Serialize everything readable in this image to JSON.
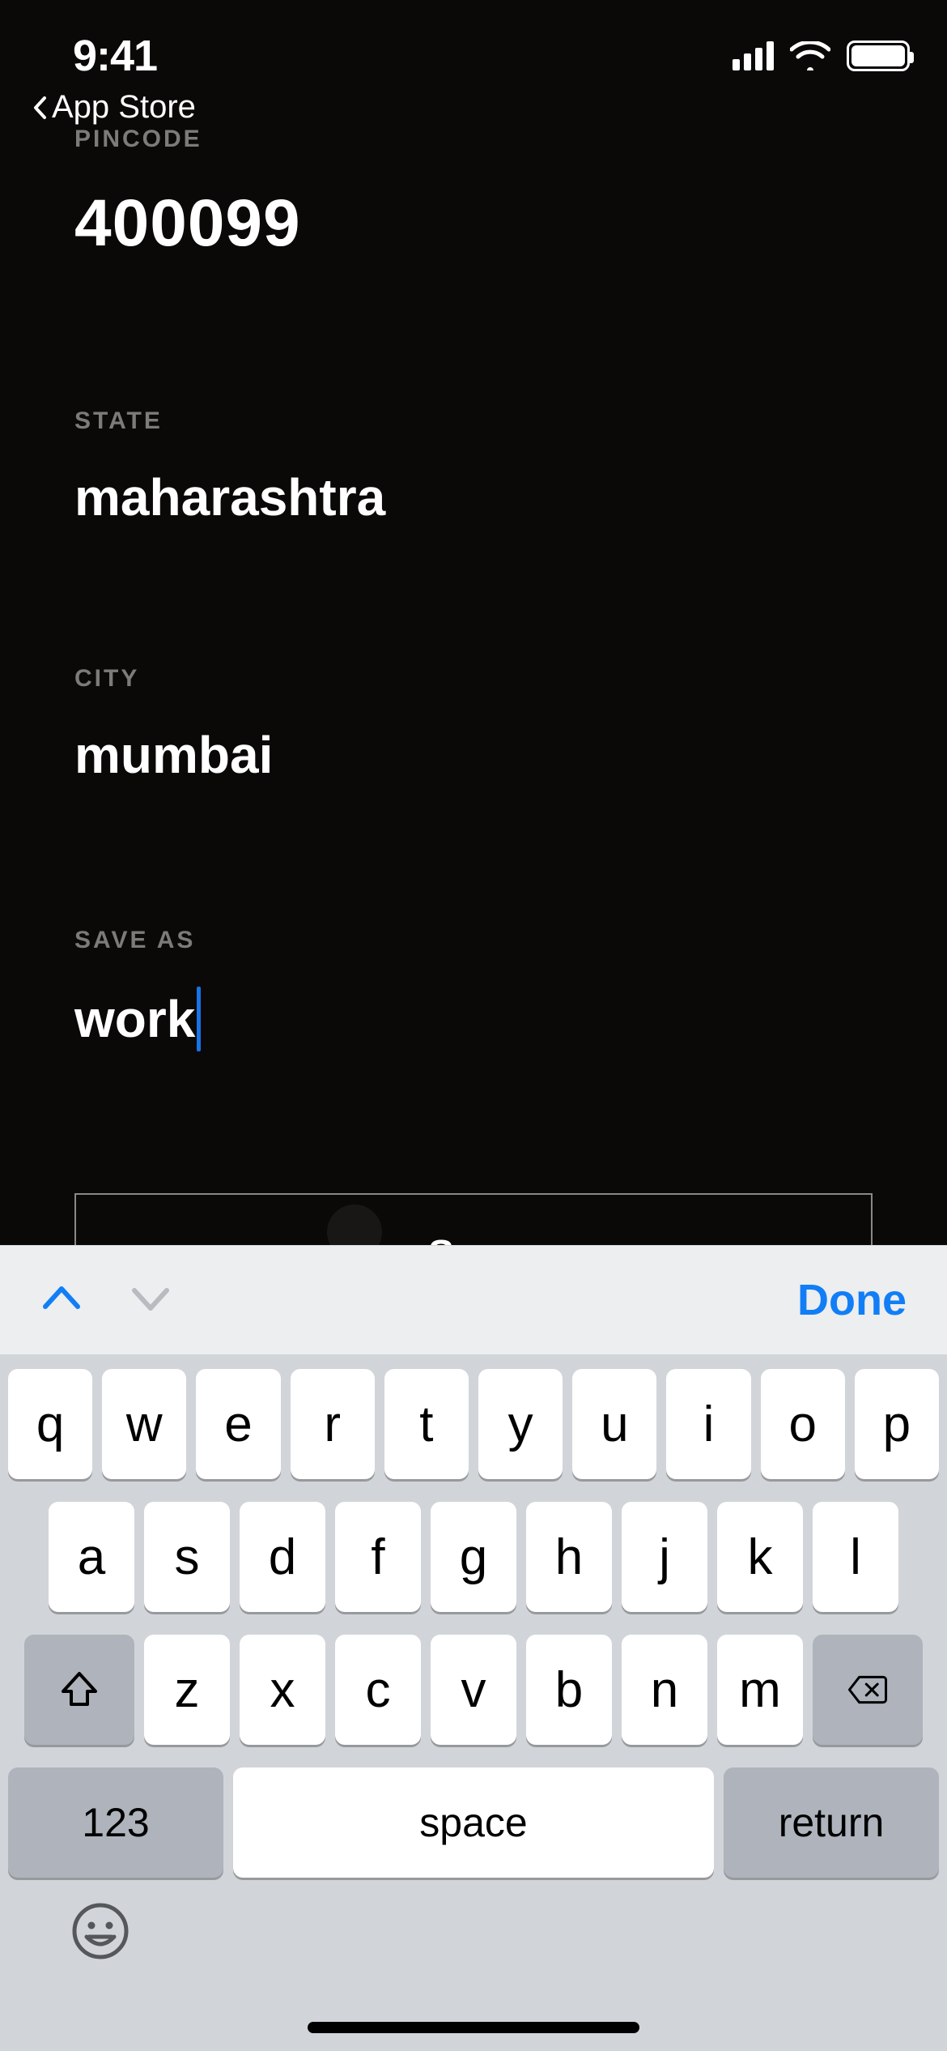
{
  "status": {
    "time": "9:41",
    "breadcrumb": "App Store"
  },
  "form": {
    "pincode": {
      "label": "PINCODE",
      "value": "400099"
    },
    "state": {
      "label": "STATE",
      "value": "maharashtra"
    },
    "city": {
      "label": "CITY",
      "value": "mumbai"
    },
    "save_as": {
      "label": "SAVE AS",
      "value": "work"
    },
    "save_button_label": "Save"
  },
  "keyboard": {
    "toolbar_done": "Done",
    "row1": [
      "q",
      "w",
      "e",
      "r",
      "t",
      "y",
      "u",
      "i",
      "o",
      "p"
    ],
    "row2": [
      "a",
      "s",
      "d",
      "f",
      "g",
      "h",
      "j",
      "k",
      "l"
    ],
    "row3": [
      "z",
      "x",
      "c",
      "v",
      "b",
      "n",
      "m"
    ],
    "numeric_label": "123",
    "space_label": "space",
    "return_label": "return"
  }
}
